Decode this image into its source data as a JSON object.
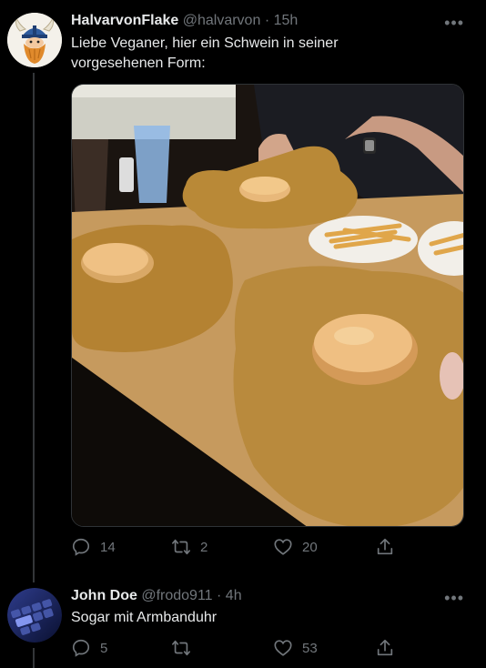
{
  "tweet": {
    "name": "HalvarvonFlake",
    "handle": "@halvarvon",
    "separator": "·",
    "time": "15h",
    "text_line1": "Liebe Veganer, hier ein Schwein in seiner",
    "text_line2": "vorgesehenen Form:",
    "replies": "14",
    "retweets": "2",
    "likes": "20",
    "avatar_icon": "viking-icon",
    "media_icon": "food-photo"
  },
  "reply": {
    "name": "John Doe",
    "handle": "@frodo911",
    "separator": "·",
    "time": "4h",
    "text": "Sogar mit Armbanduhr",
    "replies": "5",
    "retweets": "",
    "likes": "53",
    "avatar_icon": "keyboard-photo-icon"
  },
  "colors": {
    "background": "#000000",
    "text": "#e7e9ea",
    "secondary": "#71767b",
    "thread_line": "#333639"
  }
}
